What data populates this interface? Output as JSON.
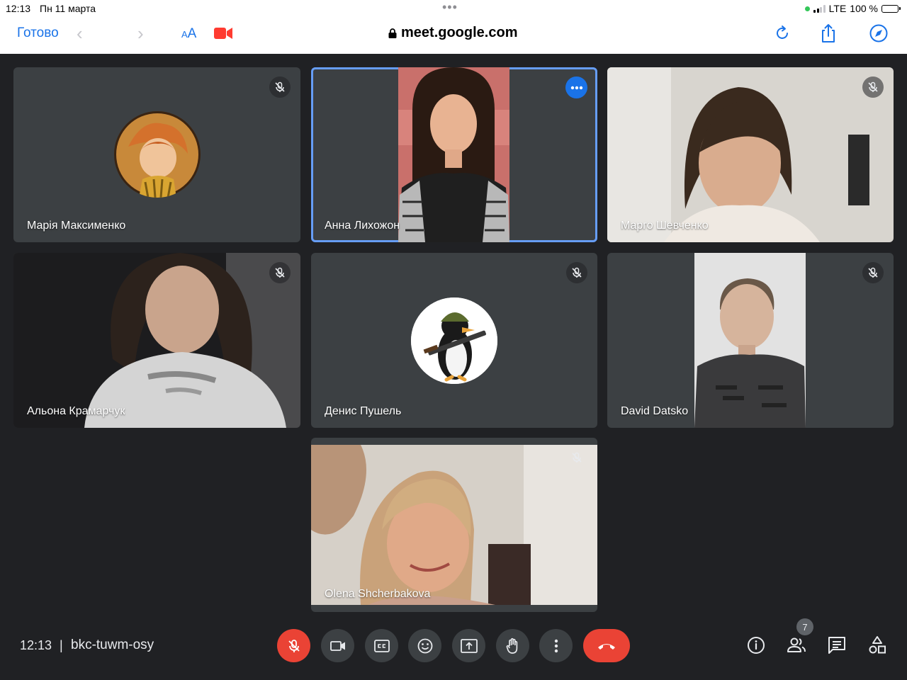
{
  "status_bar": {
    "time": "12:13",
    "date": "Пн 11 марта",
    "network": "LTE",
    "battery": "100 %"
  },
  "browser": {
    "done_label": "Готово",
    "text_size_small": "A",
    "text_size_large": "A",
    "url": "meet.google.com"
  },
  "participants": [
    {
      "name": "Марія Максименко",
      "muted": true,
      "video": false
    },
    {
      "name": "Анна Лихожон",
      "muted": false,
      "video": true,
      "active_speaker": true
    },
    {
      "name": "Марго Шевченко",
      "muted": true,
      "video": true
    },
    {
      "name": "Альона Крамарчук",
      "muted": true,
      "video": true
    },
    {
      "name": "Денис Пушель",
      "muted": true,
      "video": false
    },
    {
      "name": "David Datsko",
      "muted": true,
      "video": true
    },
    {
      "name": "Olena Shcherbakova",
      "muted": true,
      "video": true
    }
  ],
  "bottom_bar": {
    "time": "12:13",
    "separator": "|",
    "meeting_code": "bkc-tuwm-osy",
    "people_count": "7"
  },
  "colors": {
    "background": "#202124",
    "tile": "#3c4043",
    "accent_blue": "#1a73e8",
    "active_outline": "#669df6",
    "danger_red": "#ea4335"
  }
}
